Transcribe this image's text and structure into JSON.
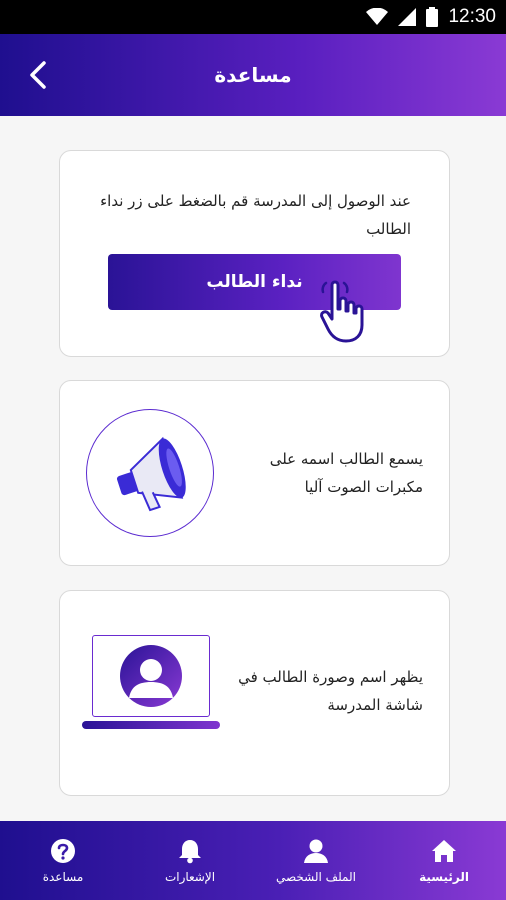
{
  "statusbar": {
    "time": "12:30"
  },
  "header": {
    "title": "مساعدة"
  },
  "card1": {
    "text": "عند الوصول إلى المدرسة قم بالضغط على زر نداء الطالب",
    "button_label": "نداء الطالب"
  },
  "card2": {
    "text": "يسمع الطالب اسمه  على مكبرات الصوت آليا"
  },
  "card3": {
    "text": "يظهر اسم وصورة الطالب في شاشة المدرسة"
  },
  "bottom_nav": {
    "home": "الرئيسية",
    "profile": "الملف الشخصي",
    "notifications": "الإشعارات",
    "help": "مساعدة"
  },
  "colors": {
    "primary": "#2a1396",
    "accent": "#7f35cf"
  }
}
